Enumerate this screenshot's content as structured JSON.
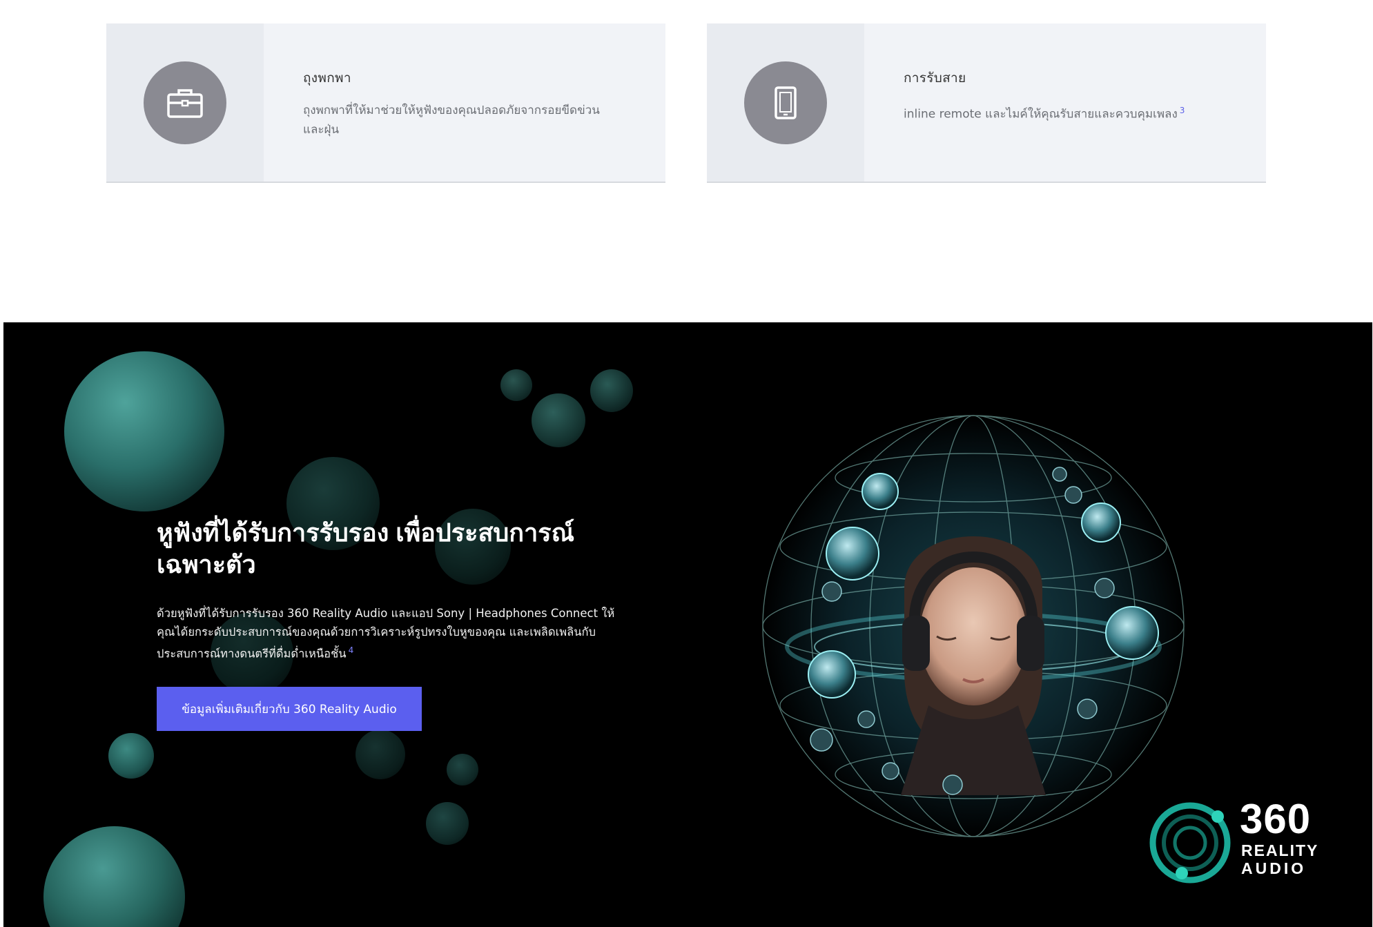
{
  "features": [
    {
      "icon": "briefcase-icon",
      "title": "ถุงพกพา",
      "description": "ถุงพกพาที่ให้มาช่วยให้หูฟังของคุณปลอดภัยจากรอยขีดข่วนและฝุ่น",
      "footnote": ""
    },
    {
      "icon": "smartphone-icon",
      "title": "การรับสาย",
      "description": "inline remote และไมค์ให้คุณรับสายและควบคุมเพลง",
      "footnote": "3"
    }
  ],
  "hero": {
    "headline": "หูฟังที่ได้รับการรับรอง เพื่อประสบการณ์เฉพาะตัว",
    "body": "ด้วยหูฟังที่ได้รับการรับรอง 360 Reality Audio และแอป Sony | Headphones Connect ให้คุณได้ยกระดับประสบการณ์ของคุณด้วยการวิเคราะห์รูปทรงใบหูของคุณ และเพลิดเพลินกับประสบการณ์ทางดนตรีที่ดื่มด่ำเหนือชั้น",
    "footnote": "4",
    "cta_label": "ข้อมูลเพิ่มเติมเกี่ยวกับ 360 Reality Audio",
    "logo": {
      "number": "360",
      "word1": "REALITY",
      "word2": "AUDIO"
    },
    "accent_color": "#5b5fef",
    "bubble_color": "#2f7f7a"
  }
}
